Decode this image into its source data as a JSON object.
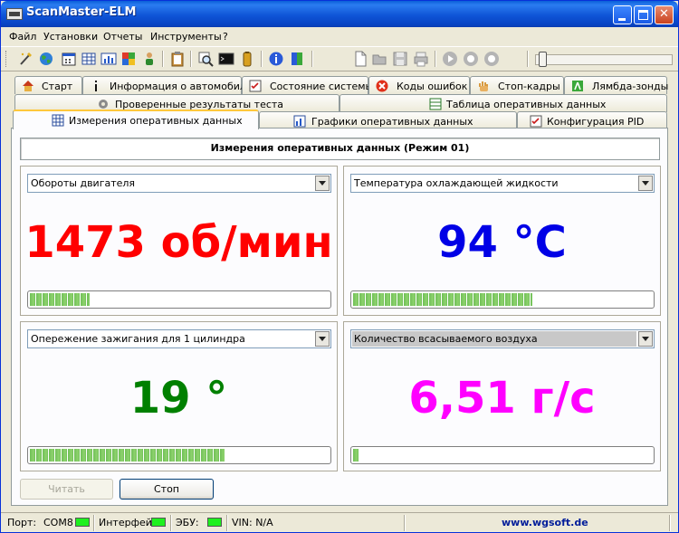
{
  "window": {
    "title": "ScanMaster-ELM"
  },
  "menu": [
    "Файл",
    "Установки",
    "Отчеты",
    "Инструменты",
    "?"
  ],
  "toolbar_icons": [
    "wizard-icon",
    "globe-icon",
    "calendar-icon",
    "chart-icon",
    "flag-icon",
    "person-icon",
    "clipboard-icon",
    "magnifier-icon",
    "terminal-icon",
    "battery-icon",
    "info-icon",
    "dictionary-icon",
    "new-file-icon",
    "open-folder-icon",
    "save-icon",
    "print-icon",
    "play-icon",
    "pause-icon",
    "stop-icon"
  ],
  "tabs_row1": [
    "Старт",
    "Информация о автомобиле",
    "Состояние системы",
    "Коды ошибок",
    "Стоп-кадры",
    "Лямбда-зонды"
  ],
  "tabs_row2": [
    "Проверенные результаты теста",
    "Таблица оперативных данных"
  ],
  "tabs_row3": [
    "Измерения оперативных данных",
    "Графики оперативных данных",
    "Конфигурация PID"
  ],
  "page_title": "Измерения оперативных данных (Режим 01)",
  "colors": {
    "rpm": "#ff0000",
    "temp": "#0000e6",
    "timing": "#008000",
    "maf": "#ff00ff",
    "bar": "#6fbf57"
  },
  "gauges": [
    {
      "pid": "Обороты двигателя",
      "value": "1473 об/мин",
      "level": 0.2
    },
    {
      "pid": "Температура охлаждающей жидкости",
      "value": "94 °C",
      "level": 0.6
    },
    {
      "pid": "Опережение зажигания для 1 цилиндра",
      "value": "19 °",
      "level": 0.65
    },
    {
      "pid": "Количество всасываемого воздуха",
      "value": "6,51 г/с",
      "level": 0.02
    }
  ],
  "buttons": {
    "read": "Читать",
    "stop": "Стоп"
  },
  "status": {
    "port_label": "Порт:",
    "port_value": "COM8",
    "interface_label": "Интерфейс:",
    "ecu_label": "ЭБУ:",
    "vin": "VIN: N/A",
    "link": "www.wgsoft.de"
  }
}
